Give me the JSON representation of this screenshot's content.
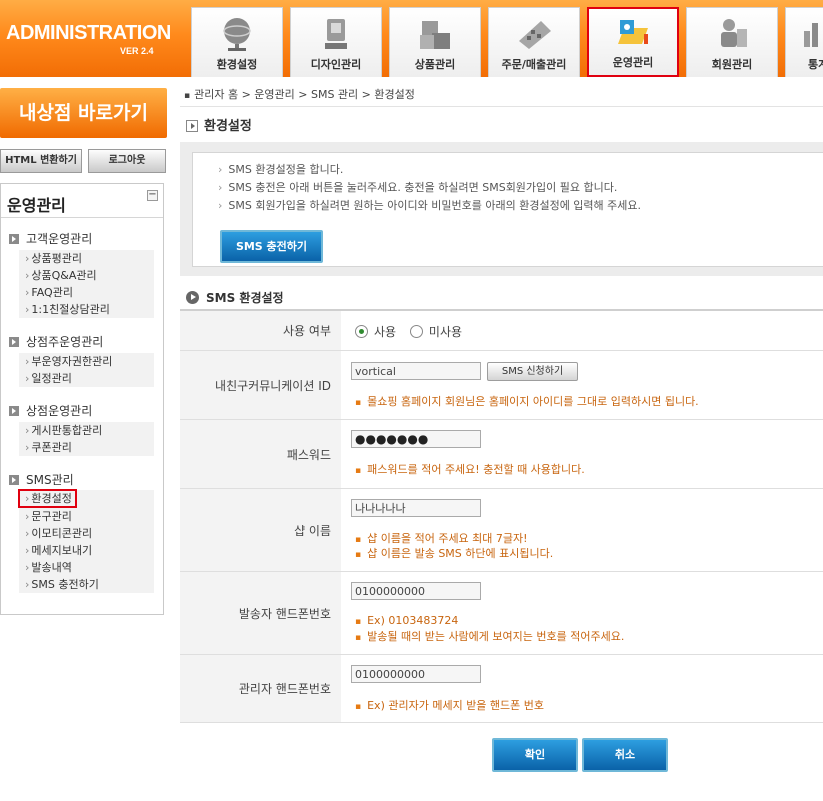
{
  "header": {
    "logo": "ADMINISTRATION",
    "version": "VER 2.4",
    "tabs": [
      {
        "label": "환경설정",
        "icon": "globe-icon",
        "active": false
      },
      {
        "label": "디자인관리",
        "icon": "design-tools-icon",
        "active": false
      },
      {
        "label": "상품관리",
        "icon": "boxes-icon",
        "active": false
      },
      {
        "label": "주문/매출관리",
        "icon": "calculator-icon",
        "active": false
      },
      {
        "label": "운영관리",
        "icon": "folder-icon",
        "active": true
      },
      {
        "label": "회원관리",
        "icon": "members-icon",
        "active": false
      },
      {
        "label": "통계",
        "icon": "stats-icon",
        "active": false
      }
    ]
  },
  "sidebar": {
    "shop_link": "내상점 바로가기",
    "html_button": "HTML 변환하기",
    "logout_button": "로그아웃",
    "title": "운영관리",
    "collapse": "−",
    "groups": [
      {
        "title": "고객운영관리",
        "items": [
          "상품평관리",
          "상품Q&A관리",
          "FAQ관리",
          "1:1친절상담관리"
        ]
      },
      {
        "title": "상점주운영관리",
        "items": [
          "부운영자권한관리",
          "일정관리"
        ]
      },
      {
        "title": "상점운영관리",
        "items": [
          "게시판통합관리",
          "쿠폰관리"
        ]
      },
      {
        "title": "SMS관리",
        "items": [
          "환경설정",
          "문구관리",
          "이모티콘관리",
          "메세지보내기",
          "발송내역",
          "SMS 충전하기"
        ]
      }
    ]
  },
  "breadcrumb": "관리자 홈 > 운영관리 > SMS 관리 > 환경설정",
  "page_title": "환경설정",
  "info": {
    "lines": [
      "SMS 환경설정을 합니다.",
      "SMS 충전은 아래 버튼을 눌러주세요. 충전을 하실려면 SMS회원가입이 필요 합니다.",
      "SMS 회원가입을 하실려면 원하는 아이디와 비밀번호를 아래의 환경설정에 입력해 주세요."
    ],
    "charge_button": "SMS 충전하기"
  },
  "section_title": "SMS 환경설정",
  "form": {
    "use": {
      "label": "사용 여부",
      "on": "사용",
      "off": "미사용"
    },
    "account": {
      "label": "내친구커뮤니케이션 ID",
      "value": "vortical",
      "button": "SMS 신청하기",
      "note": "몰쇼핑 홈페이지 회원님은 홈페이지 아이디를 그대로 입력하시면 됩니다."
    },
    "password": {
      "label": "패스워드",
      "value": "●●●●●●●",
      "note": "패스워드를 적어 주세요! 충전할 때 사용합니다."
    },
    "shop_name": {
      "label": "샵 이름",
      "value": "나나나나나",
      "note1": "샵 이름을 적어 주세요 최대 7글자!",
      "note2": "샵 이름은 발송 SMS 하단에 표시됩니다."
    },
    "sender": {
      "label": "발송자 핸드폰번호",
      "value": "0100000000",
      "note1": "Ex) 0103483724",
      "note2": "발송될 때의 받는 사람에게 보여지는 번호를 적어주세요."
    },
    "admin": {
      "label": "관리자 핸드폰번호",
      "value": "0100000000",
      "note": "Ex) 관리자가 메세지 받을 핸드폰 번호"
    }
  },
  "buttons": {
    "confirm": "확인",
    "cancel": "취소"
  }
}
